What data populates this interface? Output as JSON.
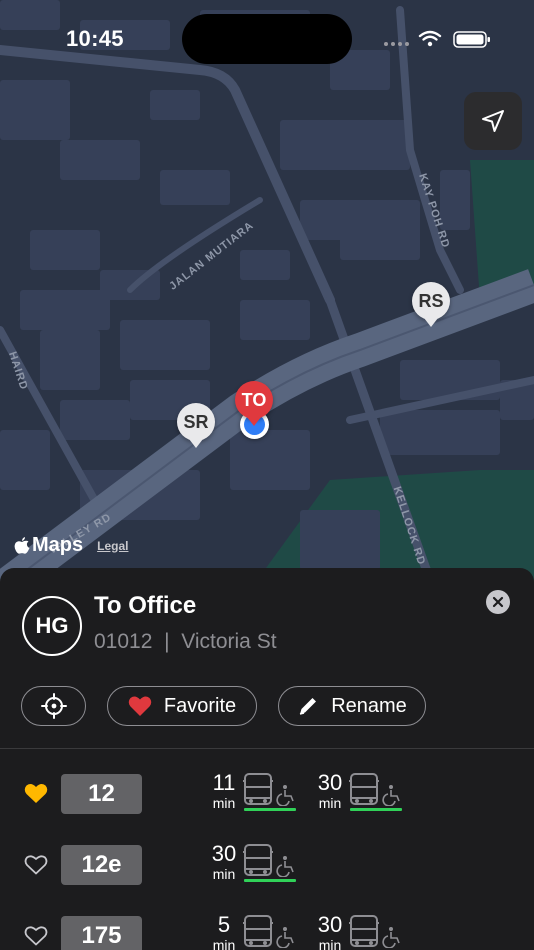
{
  "status_bar": {
    "time": "10:45"
  },
  "map": {
    "streets": [
      "JALAN MUTIARA",
      "KAY POH RD",
      "VALLEY RD",
      "KELLOCK RD",
      "HAIRD"
    ],
    "pins": [
      {
        "label": "RS",
        "color": "#e9e9eb"
      },
      {
        "label": "SR",
        "color": "#e9e9eb"
      },
      {
        "label": "TO",
        "color": "#e0393e"
      }
    ],
    "attribution": {
      "brand": "Maps",
      "legal": "Legal"
    },
    "locate_icon": "location-arrow-icon"
  },
  "stop": {
    "avatar": "HG",
    "title": "To Office",
    "code": "01012",
    "separator": "|",
    "road": "Victoria St"
  },
  "actions": {
    "locate_icon": "crosshair-icon",
    "favorite_label": "Favorite",
    "rename_label": "Rename"
  },
  "services": [
    {
      "number": "12",
      "favorite": true,
      "arrivals": [
        {
          "minutes": "11",
          "unit": "min"
        },
        {
          "minutes": "30",
          "unit": "min"
        }
      ]
    },
    {
      "number": "12e",
      "favorite": false,
      "arrivals": [
        {
          "minutes": "30",
          "unit": "min"
        }
      ]
    },
    {
      "number": "175",
      "favorite": false,
      "arrivals": [
        {
          "minutes": "5",
          "unit": "min"
        },
        {
          "minutes": "30",
          "unit": "min"
        }
      ]
    }
  ],
  "colors": {
    "accent_heart": "#e0393e",
    "favorite_gold": "#ffb800",
    "load_green": "#30d158",
    "map_bg": "#2b3446"
  }
}
